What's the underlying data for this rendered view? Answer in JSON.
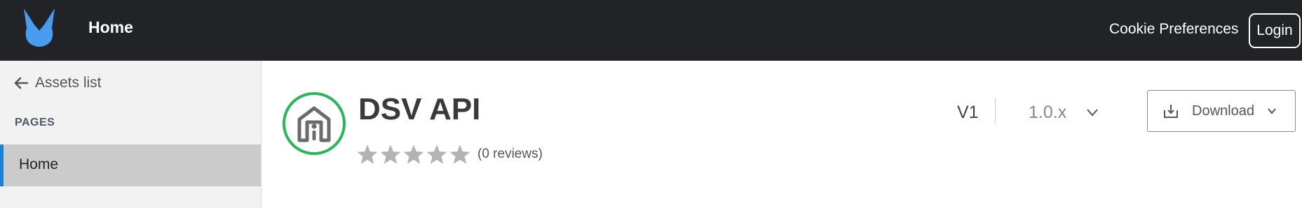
{
  "header": {
    "home_label": "Home",
    "cookie_label": "Cookie Preferences",
    "login_label": "Login",
    "logo_icon": "bunny-logo-icon",
    "logo_color": "#4a9cf0"
  },
  "sidebar": {
    "back_label": "Assets list",
    "back_icon": "arrow-left-icon",
    "section_heading": "PAGES",
    "items": [
      {
        "label": "Home",
        "active": true
      }
    ],
    "active_accent": "#1a7fd6"
  },
  "api": {
    "title": "DSV API",
    "icon": "api-house-icon",
    "icon_ring_color": "#2ab55c",
    "rating": 0,
    "max_rating": 5,
    "reviews_label": "(0 reviews)",
    "version": "V1",
    "release": "1.0.x",
    "download_label": "Download"
  }
}
